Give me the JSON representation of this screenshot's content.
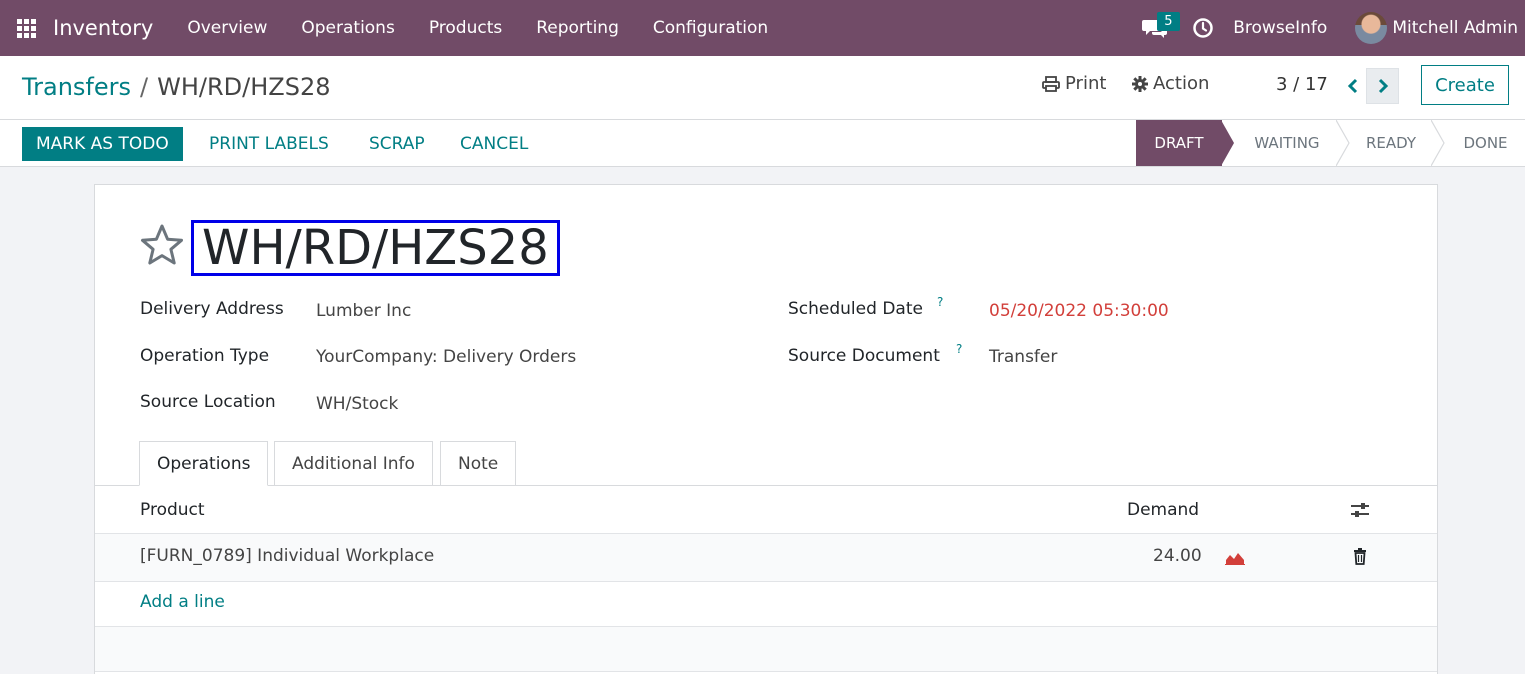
{
  "navbar": {
    "app_name": "Inventory",
    "menu": [
      "Overview",
      "Operations",
      "Products",
      "Reporting",
      "Configuration"
    ],
    "chat_count": "5",
    "company": "BrowseInfo",
    "user": "Mitchell Admin"
  },
  "breadcrumb": {
    "parent": "Transfers",
    "separator": "/",
    "current": "WH/RD/HZS28"
  },
  "control_panel": {
    "print_label": "Print",
    "action_label": "Action",
    "pager": "3 / 17",
    "create_label": "Create"
  },
  "statusbar": {
    "buttons": [
      "MARK AS TODO",
      "PRINT LABELS",
      "SCRAP",
      "CANCEL"
    ],
    "stages": [
      "DRAFT",
      "WAITING",
      "READY",
      "DONE"
    ],
    "active_stage": "DRAFT"
  },
  "form": {
    "reference": "WH/RD/HZS28",
    "fields_left": [
      {
        "label": "Delivery Address",
        "value": "Lumber Inc"
      },
      {
        "label": "Operation Type",
        "value": "YourCompany: Delivery Orders"
      },
      {
        "label": "Source Location",
        "value": "WH/Stock"
      }
    ],
    "fields_right": [
      {
        "label": "Scheduled Date",
        "help": "?",
        "value": "05/20/2022 05:30:00"
      },
      {
        "label": "Source Document",
        "help": "?",
        "value": "Transfer"
      }
    ],
    "tabs": [
      "Operations",
      "Additional Info",
      "Note"
    ],
    "table": {
      "headers": [
        "Product",
        "Demand"
      ],
      "rows": [
        {
          "product": "[FURN_0789] Individual Workplace",
          "demand": "24.00"
        }
      ],
      "add_line": "Add a line"
    }
  },
  "colors": {
    "brand": "#714b67",
    "accent": "#017e84",
    "danger": "#d23f3a",
    "title_outline": "#0000e8"
  }
}
